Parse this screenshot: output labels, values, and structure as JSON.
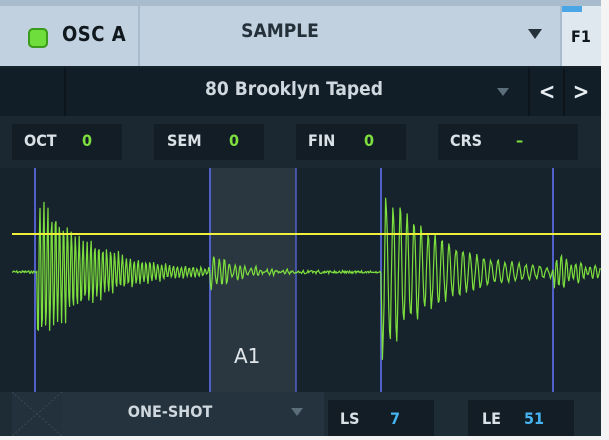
{
  "oscillator": {
    "name": "OSC A",
    "enabled_color": "#6ede3c",
    "source_type": "SAMPLE",
    "filter_route": "F1"
  },
  "preset": {
    "name": "80 Brooklyn Taped",
    "prev_icon": "chevron-left-icon",
    "next_icon": "chevron-right-icon",
    "prev_glyph": "<",
    "next_glyph": ">"
  },
  "tuning": {
    "oct_label": "OCT",
    "oct_value": "0",
    "sem_label": "SEM",
    "sem_value": "0",
    "fin_label": "FIN",
    "fin_value": "0",
    "crs_label": "CRS",
    "crs_value": "–"
  },
  "waveform": {
    "root_note": "A1",
    "waveform_color": "#7ee03e",
    "level_line_color": "#f0f03c",
    "marker_color": "#5160c8"
  },
  "playback": {
    "mode": "ONE-SHOT",
    "ls_label": "LS",
    "ls_value": "7",
    "le_label": "LE",
    "le_value": "51"
  }
}
